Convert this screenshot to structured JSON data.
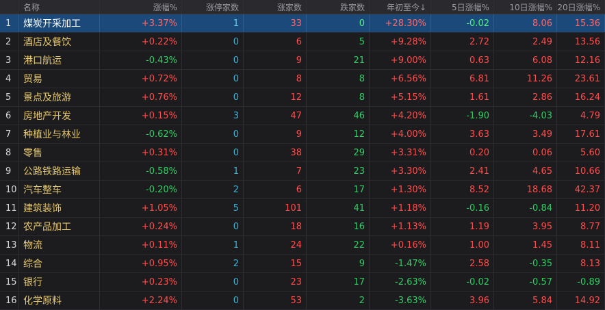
{
  "headers": [
    "",
    "名称",
    "涨幅%",
    "涨停家数",
    "涨家数",
    "跌家数",
    "年初至今↓",
    "5日涨幅%",
    "10日涨幅%",
    "20日涨幅%"
  ],
  "rows": [
    {
      "idx": "1",
      "name": "煤炭开采加工",
      "chg": "+3.37%",
      "limit": "1",
      "up": "33",
      "down": "0",
      "ytd": "+28.30%",
      "d5": "-0.02",
      "d10": "8.06",
      "d20": "15.36"
    },
    {
      "idx": "2",
      "name": "酒店及餐饮",
      "chg": "+0.22%",
      "limit": "0",
      "up": "6",
      "down": "5",
      "ytd": "+9.28%",
      "d5": "2.72",
      "d10": "2.49",
      "d20": "13.56"
    },
    {
      "idx": "3",
      "name": "港口航运",
      "chg": "-0.43%",
      "limit": "0",
      "up": "9",
      "down": "21",
      "ytd": "+9.00%",
      "d5": "0.63",
      "d10": "6.08",
      "d20": "12.16"
    },
    {
      "idx": "4",
      "name": "贸易",
      "chg": "+0.72%",
      "limit": "0",
      "up": "8",
      "down": "8",
      "ytd": "+6.56%",
      "d5": "6.81",
      "d10": "11.26",
      "d20": "23.61"
    },
    {
      "idx": "5",
      "name": "景点及旅游",
      "chg": "+0.76%",
      "limit": "0",
      "up": "12",
      "down": "8",
      "ytd": "+5.15%",
      "d5": "1.61",
      "d10": "2.86",
      "d20": "16.24"
    },
    {
      "idx": "6",
      "name": "房地产开发",
      "chg": "+0.15%",
      "limit": "3",
      "up": "47",
      "down": "46",
      "ytd": "+4.20%",
      "d5": "-1.90",
      "d10": "-4.03",
      "d20": "4.79"
    },
    {
      "idx": "7",
      "name": "种植业与林业",
      "chg": "-0.62%",
      "limit": "0",
      "up": "9",
      "down": "12",
      "ytd": "+4.00%",
      "d5": "3.63",
      "d10": "3.49",
      "d20": "17.61"
    },
    {
      "idx": "8",
      "name": "零售",
      "chg": "+0.31%",
      "limit": "0",
      "up": "38",
      "down": "29",
      "ytd": "+3.31%",
      "d5": "0.20",
      "d10": "0.06",
      "d20": "5.60"
    },
    {
      "idx": "9",
      "name": "公路铁路运输",
      "chg": "-0.58%",
      "limit": "1",
      "up": "7",
      "down": "23",
      "ytd": "+3.30%",
      "d5": "2.41",
      "d10": "4.65",
      "d20": "10.66"
    },
    {
      "idx": "10",
      "name": "汽车整车",
      "chg": "-0.20%",
      "limit": "2",
      "up": "6",
      "down": "17",
      "ytd": "+1.30%",
      "d5": "8.52",
      "d10": "18.68",
      "d20": "42.37"
    },
    {
      "idx": "11",
      "name": "建筑装饰",
      "chg": "+1.05%",
      "limit": "5",
      "up": "101",
      "down": "41",
      "ytd": "+1.18%",
      "d5": "-0.16",
      "d10": "-0.84",
      "d20": "11.20"
    },
    {
      "idx": "12",
      "name": "农产品加工",
      "chg": "+0.24%",
      "limit": "0",
      "up": "18",
      "down": "16",
      "ytd": "+1.13%",
      "d5": "1.19",
      "d10": "3.95",
      "d20": "8.77"
    },
    {
      "idx": "13",
      "name": "物流",
      "chg": "+0.11%",
      "limit": "1",
      "up": "24",
      "down": "22",
      "ytd": "+0.16%",
      "d5": "1.00",
      "d10": "1.45",
      "d20": "8.11"
    },
    {
      "idx": "14",
      "name": "综合",
      "chg": "+0.95%",
      "limit": "2",
      "up": "15",
      "down": "9",
      "ytd": "-1.47%",
      "d5": "2.58",
      "d10": "-0.35",
      "d20": "8.13"
    },
    {
      "idx": "15",
      "name": "银行",
      "chg": "+0.23%",
      "limit": "0",
      "up": "23",
      "down": "17",
      "ytd": "-2.63%",
      "d5": "-0.02",
      "d10": "-0.57",
      "d20": "-0.89"
    },
    {
      "idx": "16",
      "name": "化学原料",
      "chg": "+2.24%",
      "limit": "0",
      "up": "53",
      "down": "2",
      "ytd": "-3.63%",
      "d5": "3.96",
      "d10": "5.84",
      "d20": "14.92"
    }
  ],
  "colors": {
    "up": "#ff4d4d",
    "down": "#33cc66",
    "limit": "#3fb3d6",
    "name": "#e6c76b",
    "selected_bg": "#1b4a7a"
  }
}
